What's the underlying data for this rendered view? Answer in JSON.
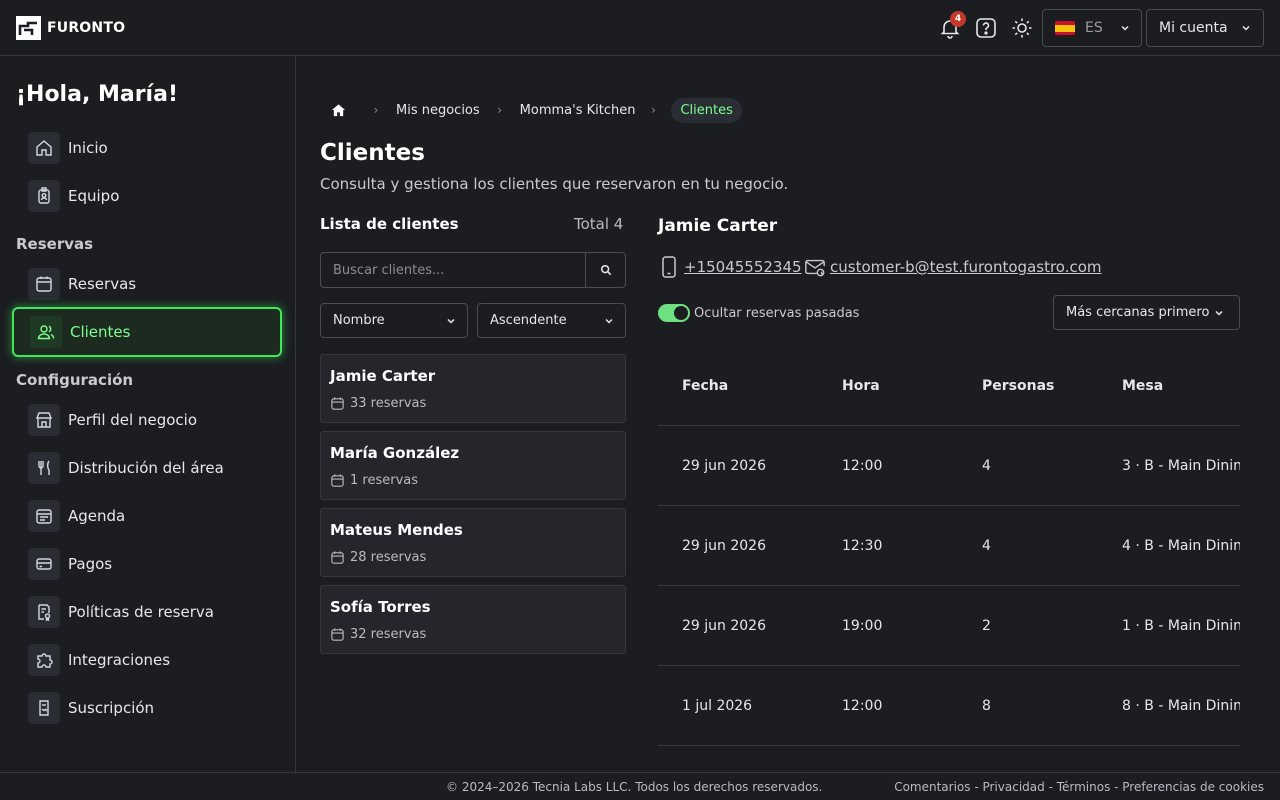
{
  "app": {
    "logo_text": "FURONTO"
  },
  "topbar": {
    "notifications_count": "4",
    "language_label": "ES",
    "account_label": "Mi cuenta"
  },
  "sidebar": {
    "greeting": "¡Hola, María!",
    "items": [
      {
        "label": "Inicio",
        "icon": "home-icon"
      },
      {
        "label": "Equipo",
        "icon": "badge-icon"
      }
    ],
    "section_reservas": "Reservas",
    "reservas_items": [
      {
        "label": "Reservas",
        "icon": "calendar-icon"
      },
      {
        "label": "Clientes",
        "icon": "users-icon",
        "active": true
      }
    ],
    "section_config": "Configuración",
    "config_items": [
      {
        "label": "Perfil del negocio",
        "icon": "store-icon"
      },
      {
        "label": "Distribución del área",
        "icon": "utensils-icon"
      },
      {
        "label": "Agenda",
        "icon": "agenda-icon"
      },
      {
        "label": "Pagos",
        "icon": "card-icon"
      },
      {
        "label": "Políticas de reserva",
        "icon": "policy-icon"
      },
      {
        "label": "Integraciones",
        "icon": "puzzle-icon"
      },
      {
        "label": "Suscripción",
        "icon": "subscription-icon"
      }
    ]
  },
  "breadcrumb": {
    "items": [
      "Mis negocios",
      "Momma's Kitchen"
    ],
    "current": "Clientes"
  },
  "page": {
    "title": "Clientes",
    "subtitle": "Consulta y gestiona los clientes que reservaron en tu negocio."
  },
  "client_list": {
    "title": "Lista de clientes",
    "total": "Total 4",
    "search_placeholder": "Buscar clientes...",
    "sort_field": "Nombre",
    "sort_order": "Ascendente",
    "clients": [
      {
        "name": "Jamie Carter",
        "reservations": "33 reservas"
      },
      {
        "name": "María González",
        "reservations": "1 reservas"
      },
      {
        "name": "Mateus Mendes",
        "reservations": "28 reservas"
      },
      {
        "name": "Sofía Torres",
        "reservations": "32 reservas"
      }
    ]
  },
  "details": {
    "name": "Jamie Carter",
    "phone": "+15045552345",
    "email": "customer-b@test.furontogastro.com",
    "toggle_label": "Ocultar reservas pasadas",
    "sort_label": "Más cercanas primero",
    "columns": [
      "Fecha",
      "Hora",
      "Personas",
      "Mesa"
    ],
    "rows": [
      [
        "29 jun 2026",
        "12:00",
        "4",
        "3 · B - Main Dinin..."
      ],
      [
        "29 jun 2026",
        "12:30",
        "4",
        "4 · B - Main Dinin..."
      ],
      [
        "29 jun 2026",
        "19:00",
        "2",
        "1 · B - Main Dinin..."
      ],
      [
        "1 jul 2026",
        "12:00",
        "8",
        "8 · B - Main Dinin..."
      ]
    ]
  },
  "footer": {
    "copyright": "© 2024–2026 Tecnia Labs LLC. Todos los derechos reservados.",
    "links": "Comentarios - Privacidad - Términos - Preferencias de cookies"
  }
}
